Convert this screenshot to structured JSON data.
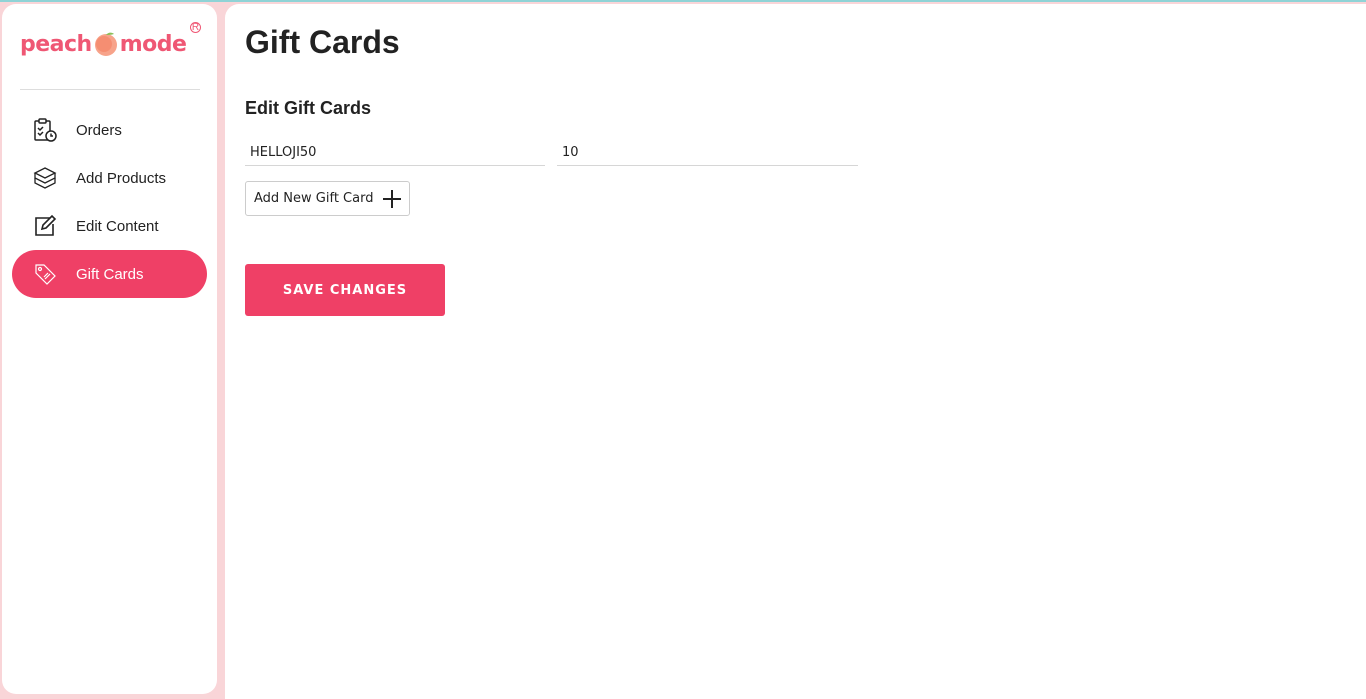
{
  "brand": {
    "part1": "peach",
    "part2": "mode",
    "reg": "R"
  },
  "nav": [
    {
      "label": "Orders",
      "icon": "clipboard-clock-icon"
    },
    {
      "label": "Add Products",
      "icon": "box-icon"
    },
    {
      "label": "Edit Content",
      "icon": "edit-icon"
    },
    {
      "label": "Gift Cards",
      "icon": "tag-icon",
      "active": true
    }
  ],
  "page": {
    "title": "Gift Cards",
    "section_title": "Edit Gift Cards"
  },
  "gift_card": {
    "code": "HELLOJI50",
    "amount": "10"
  },
  "buttons": {
    "add": "Add New Gift Card",
    "save": "SAVE CHANGES"
  },
  "colors": {
    "accent": "#ef4066",
    "background": "#f9d5d8",
    "brand": "#ef5774"
  }
}
